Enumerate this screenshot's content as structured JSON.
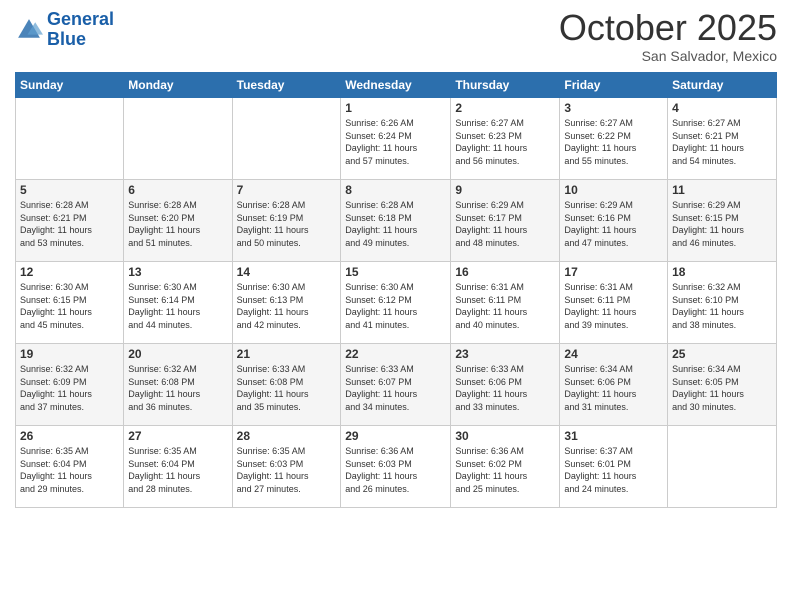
{
  "header": {
    "logo_line1": "General",
    "logo_line2": "Blue",
    "month_title": "October 2025",
    "location": "San Salvador, Mexico"
  },
  "days_of_week": [
    "Sunday",
    "Monday",
    "Tuesday",
    "Wednesday",
    "Thursday",
    "Friday",
    "Saturday"
  ],
  "weeks": [
    [
      {
        "day": "",
        "info": ""
      },
      {
        "day": "",
        "info": ""
      },
      {
        "day": "",
        "info": ""
      },
      {
        "day": "1",
        "info": "Sunrise: 6:26 AM\nSunset: 6:24 PM\nDaylight: 11 hours\nand 57 minutes."
      },
      {
        "day": "2",
        "info": "Sunrise: 6:27 AM\nSunset: 6:23 PM\nDaylight: 11 hours\nand 56 minutes."
      },
      {
        "day": "3",
        "info": "Sunrise: 6:27 AM\nSunset: 6:22 PM\nDaylight: 11 hours\nand 55 minutes."
      },
      {
        "day": "4",
        "info": "Sunrise: 6:27 AM\nSunset: 6:21 PM\nDaylight: 11 hours\nand 54 minutes."
      }
    ],
    [
      {
        "day": "5",
        "info": "Sunrise: 6:28 AM\nSunset: 6:21 PM\nDaylight: 11 hours\nand 53 minutes."
      },
      {
        "day": "6",
        "info": "Sunrise: 6:28 AM\nSunset: 6:20 PM\nDaylight: 11 hours\nand 51 minutes."
      },
      {
        "day": "7",
        "info": "Sunrise: 6:28 AM\nSunset: 6:19 PM\nDaylight: 11 hours\nand 50 minutes."
      },
      {
        "day": "8",
        "info": "Sunrise: 6:28 AM\nSunset: 6:18 PM\nDaylight: 11 hours\nand 49 minutes."
      },
      {
        "day": "9",
        "info": "Sunrise: 6:29 AM\nSunset: 6:17 PM\nDaylight: 11 hours\nand 48 minutes."
      },
      {
        "day": "10",
        "info": "Sunrise: 6:29 AM\nSunset: 6:16 PM\nDaylight: 11 hours\nand 47 minutes."
      },
      {
        "day": "11",
        "info": "Sunrise: 6:29 AM\nSunset: 6:15 PM\nDaylight: 11 hours\nand 46 minutes."
      }
    ],
    [
      {
        "day": "12",
        "info": "Sunrise: 6:30 AM\nSunset: 6:15 PM\nDaylight: 11 hours\nand 45 minutes."
      },
      {
        "day": "13",
        "info": "Sunrise: 6:30 AM\nSunset: 6:14 PM\nDaylight: 11 hours\nand 44 minutes."
      },
      {
        "day": "14",
        "info": "Sunrise: 6:30 AM\nSunset: 6:13 PM\nDaylight: 11 hours\nand 42 minutes."
      },
      {
        "day": "15",
        "info": "Sunrise: 6:30 AM\nSunset: 6:12 PM\nDaylight: 11 hours\nand 41 minutes."
      },
      {
        "day": "16",
        "info": "Sunrise: 6:31 AM\nSunset: 6:11 PM\nDaylight: 11 hours\nand 40 minutes."
      },
      {
        "day": "17",
        "info": "Sunrise: 6:31 AM\nSunset: 6:11 PM\nDaylight: 11 hours\nand 39 minutes."
      },
      {
        "day": "18",
        "info": "Sunrise: 6:32 AM\nSunset: 6:10 PM\nDaylight: 11 hours\nand 38 minutes."
      }
    ],
    [
      {
        "day": "19",
        "info": "Sunrise: 6:32 AM\nSunset: 6:09 PM\nDaylight: 11 hours\nand 37 minutes."
      },
      {
        "day": "20",
        "info": "Sunrise: 6:32 AM\nSunset: 6:08 PM\nDaylight: 11 hours\nand 36 minutes."
      },
      {
        "day": "21",
        "info": "Sunrise: 6:33 AM\nSunset: 6:08 PM\nDaylight: 11 hours\nand 35 minutes."
      },
      {
        "day": "22",
        "info": "Sunrise: 6:33 AM\nSunset: 6:07 PM\nDaylight: 11 hours\nand 34 minutes."
      },
      {
        "day": "23",
        "info": "Sunrise: 6:33 AM\nSunset: 6:06 PM\nDaylight: 11 hours\nand 33 minutes."
      },
      {
        "day": "24",
        "info": "Sunrise: 6:34 AM\nSunset: 6:06 PM\nDaylight: 11 hours\nand 31 minutes."
      },
      {
        "day": "25",
        "info": "Sunrise: 6:34 AM\nSunset: 6:05 PM\nDaylight: 11 hours\nand 30 minutes."
      }
    ],
    [
      {
        "day": "26",
        "info": "Sunrise: 6:35 AM\nSunset: 6:04 PM\nDaylight: 11 hours\nand 29 minutes."
      },
      {
        "day": "27",
        "info": "Sunrise: 6:35 AM\nSunset: 6:04 PM\nDaylight: 11 hours\nand 28 minutes."
      },
      {
        "day": "28",
        "info": "Sunrise: 6:35 AM\nSunset: 6:03 PM\nDaylight: 11 hours\nand 27 minutes."
      },
      {
        "day": "29",
        "info": "Sunrise: 6:36 AM\nSunset: 6:03 PM\nDaylight: 11 hours\nand 26 minutes."
      },
      {
        "day": "30",
        "info": "Sunrise: 6:36 AM\nSunset: 6:02 PM\nDaylight: 11 hours\nand 25 minutes."
      },
      {
        "day": "31",
        "info": "Sunrise: 6:37 AM\nSunset: 6:01 PM\nDaylight: 11 hours\nand 24 minutes."
      },
      {
        "day": "",
        "info": ""
      }
    ]
  ]
}
